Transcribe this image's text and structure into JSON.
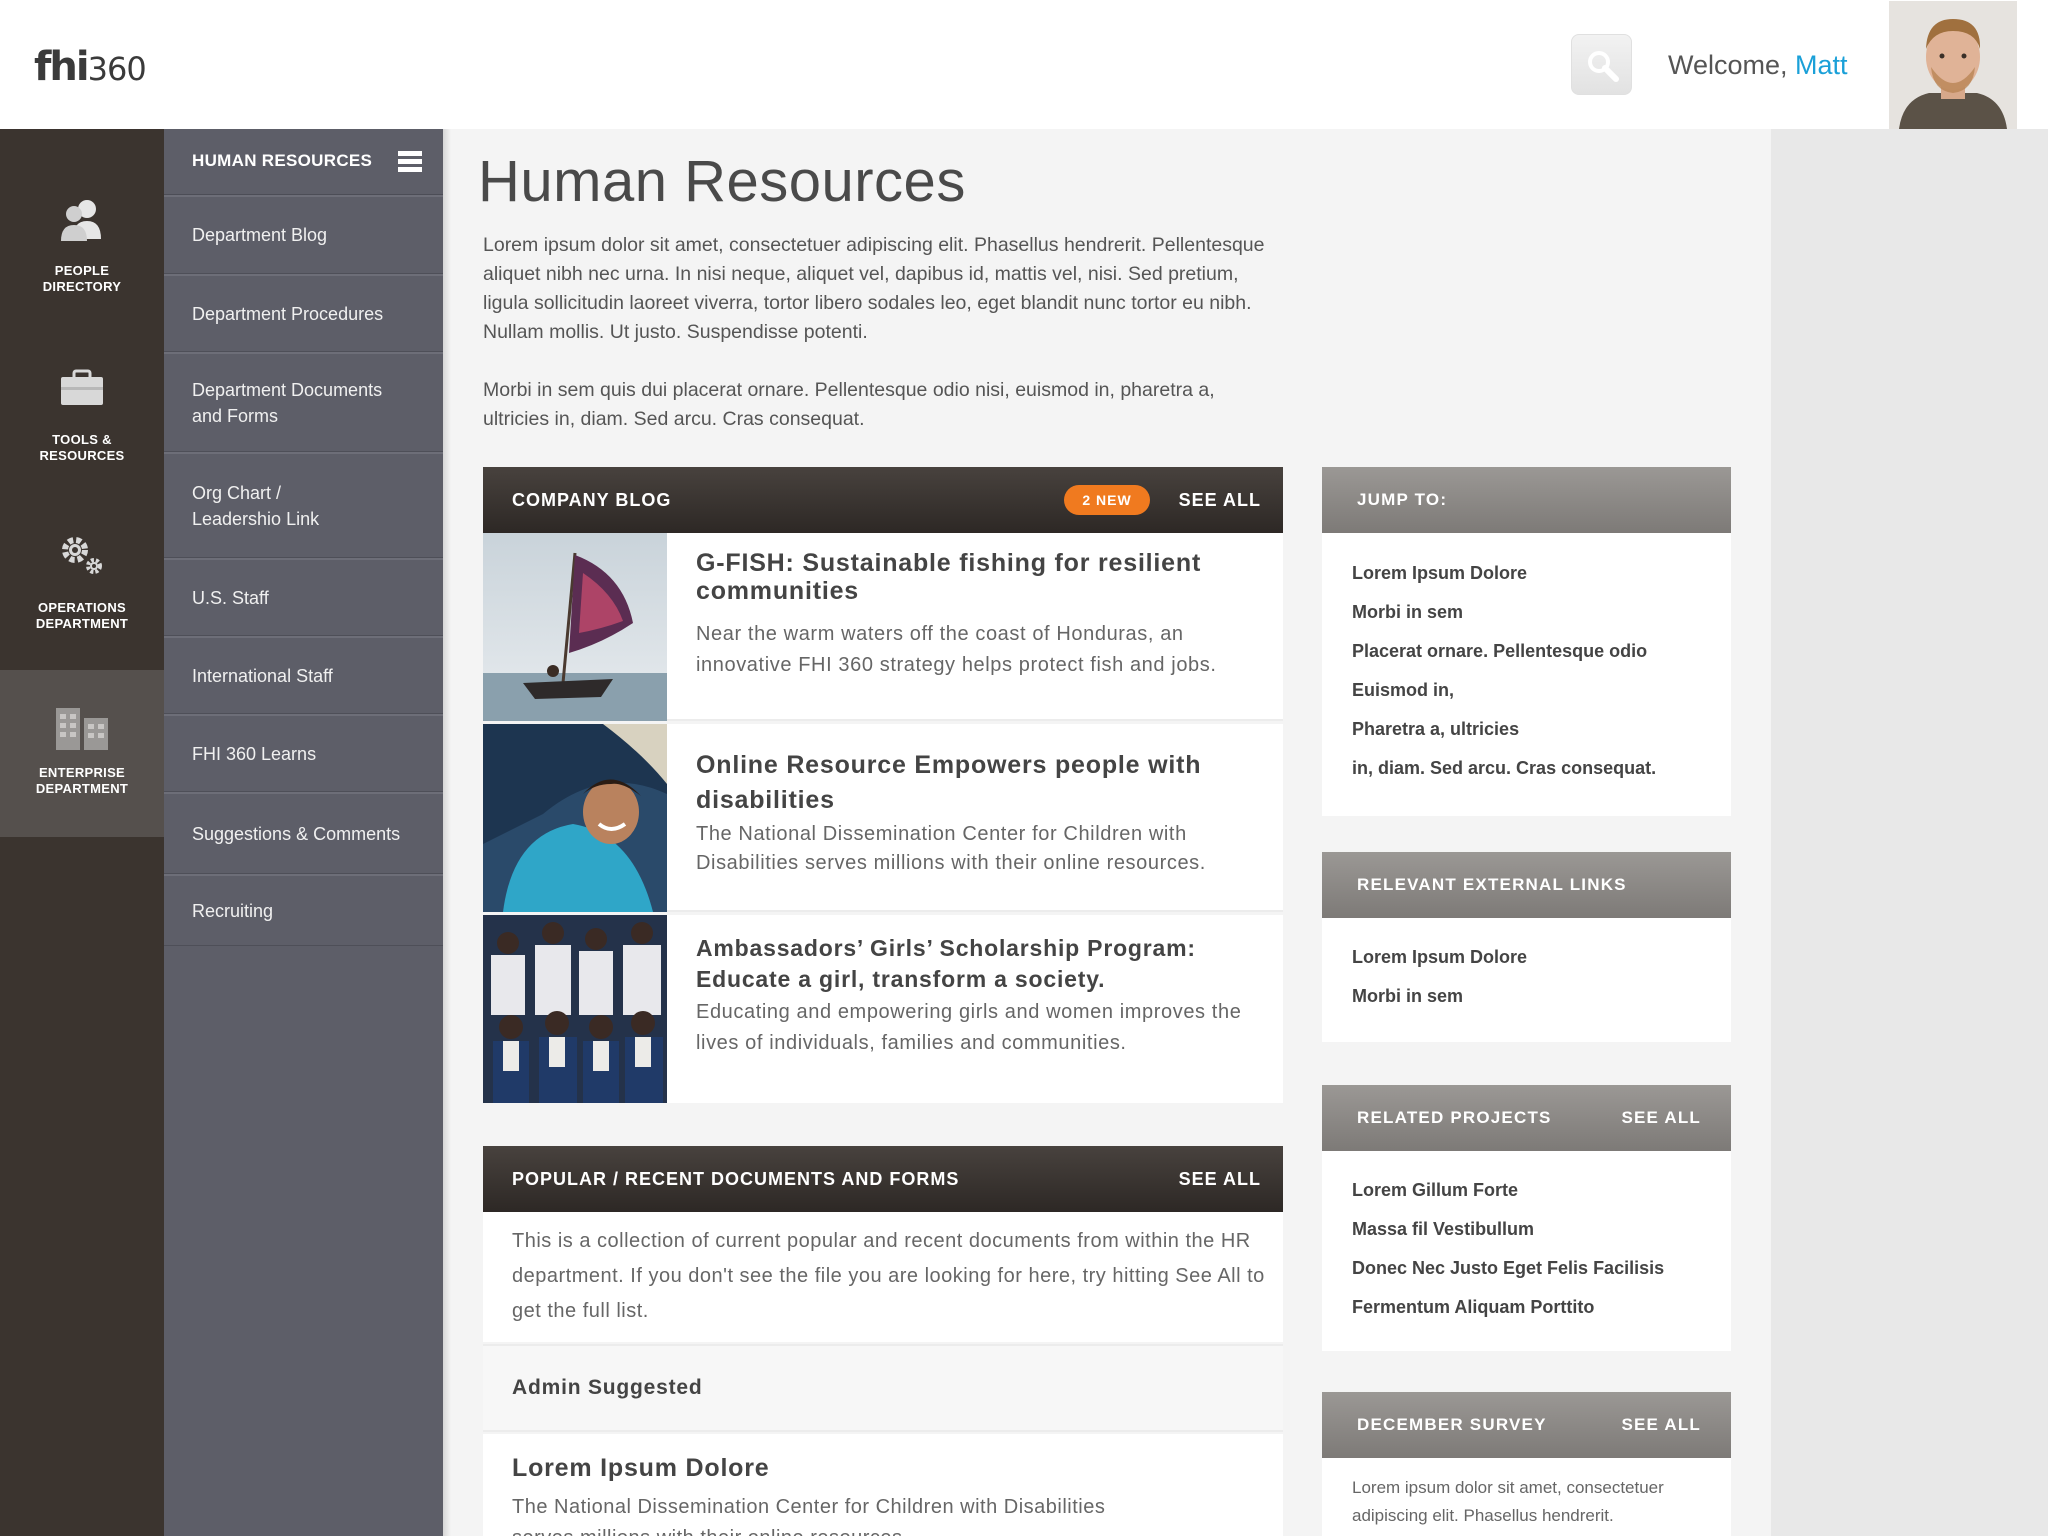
{
  "header": {
    "logo_bold": "fhi",
    "logo_num": "360",
    "welcome_prefix": "Welcome, ",
    "user_name": "Matt"
  },
  "rail": [
    {
      "label_1": "PEOPLE",
      "label_2": "DIRECTORY",
      "icon": "people-icon"
    },
    {
      "label_1": "TOOLS &",
      "label_2": "RESOURCES",
      "icon": "briefcase-icon"
    },
    {
      "label_1": "OPERATIONS",
      "label_2": "DEPARTMENT",
      "icon": "gears-icon"
    },
    {
      "label_1": "ENTERPRISE",
      "label_2": "DEPARTMENT",
      "icon": "buildings-icon",
      "active": true
    }
  ],
  "subnav": {
    "title": "HUMAN RESOURCES",
    "items": [
      {
        "line1": "Department Blog",
        "line2": ""
      },
      {
        "line1": "Department Procedures",
        "line2": ""
      },
      {
        "line1": "Department Documents",
        "line2": "and Forms"
      },
      {
        "line1": "Org Chart /",
        "line2": "Leadershio Link"
      },
      {
        "line1": "U.S. Staff",
        "line2": ""
      },
      {
        "line1": "International Staff",
        "line2": ""
      },
      {
        "line1": "FHI 360 Learns",
        "line2": ""
      },
      {
        "line1": "Suggestions & Comments",
        "line2": ""
      },
      {
        "line1": "Recruiting",
        "line2": ""
      }
    ]
  },
  "main": {
    "title": "Human Resources",
    "intro_1": "Lorem ipsum dolor sit amet, consectetuer adipiscing elit. Phasellus hendrerit. Pellentesque aliquet nibh nec urna. In nisi neque, aliquet vel, dapibus id, mattis vel, nisi. Sed pretium, ligula sollicitudin  laoreet viverra, tortor libero sodales leo, eget blandit nunc tortor eu nibh. Nullam mollis. Ut justo. Suspendisse potenti.",
    "intro_2": "Morbi in sem quis dui placerat ornare. Pellentesque odio nisi, euismod in, pharetra a, ultricies in, diam. Sed arcu. Cras consequat."
  },
  "blog": {
    "title": "COMPANY BLOG",
    "badge": "2  NEW",
    "see_all": "SEE ALL",
    "posts": [
      {
        "title": "G-FISH: Sustainable fishing for resilient communities",
        "text": "Near the warm waters off the coast of Honduras, an innovative FHI 360 strategy helps protect fish and jobs."
      },
      {
        "title": "Online Resource Empowers people with disabilities",
        "text": "The National Dissemination Center for Children with Disabilities serves millions with their online resources."
      },
      {
        "title": "Ambassadors’ Girls’ Scholarship Program: Educate a girl, transform a society.",
        "text": "Educating and empowering girls and women improves the lives of individuals, families and communities."
      }
    ]
  },
  "docs": {
    "title": "POPULAR / RECENT DOCUMENTS AND FORMS",
    "see_all": "SEE ALL",
    "description": "This is a collection of current popular and recent documents from within the HR department. If you don't see the file you are looking for here, try hitting See All to get the full list.",
    "admin_label": "Admin Suggested",
    "item_title": "Lorem Ipsum Dolore",
    "item_text": "The National Dissemination Center for Children with Disabilities serves millions with their online resources."
  },
  "jump_to": {
    "title": "JUMP TO:",
    "links": [
      "Lorem Ipsum Dolore",
      "Morbi in sem",
      "Placerat ornare. Pellentesque odio",
      "Euismod in,",
      "Pharetra a, ultricies",
      "in, diam. Sed arcu. Cras consequat."
    ]
  },
  "external_links": {
    "title": "RELEVANT EXTERNAL LINKS",
    "links": [
      "Lorem Ipsum Dolore",
      "Morbi in sem"
    ]
  },
  "related_projects": {
    "title": "RELATED PROJECTS",
    "see_all": "SEE ALL",
    "links": [
      "Lorem Gillum Forte",
      "Massa fil Vestibullum",
      "Donec Nec Justo Eget Felis Facilisis",
      "Fermentum Aliquam Porttito"
    ]
  },
  "survey": {
    "title": "DECEMBER SURVEY",
    "see_all": "SEE ALL",
    "text": "Lorem ipsum dolor sit amet, consectetuer adipiscing elit. Phasellus hendrerit."
  },
  "colors": {
    "accent": "#1aa0d8",
    "badge": "#f07a1f",
    "rail": "#3b342f",
    "subnav": "#5d5e68"
  }
}
